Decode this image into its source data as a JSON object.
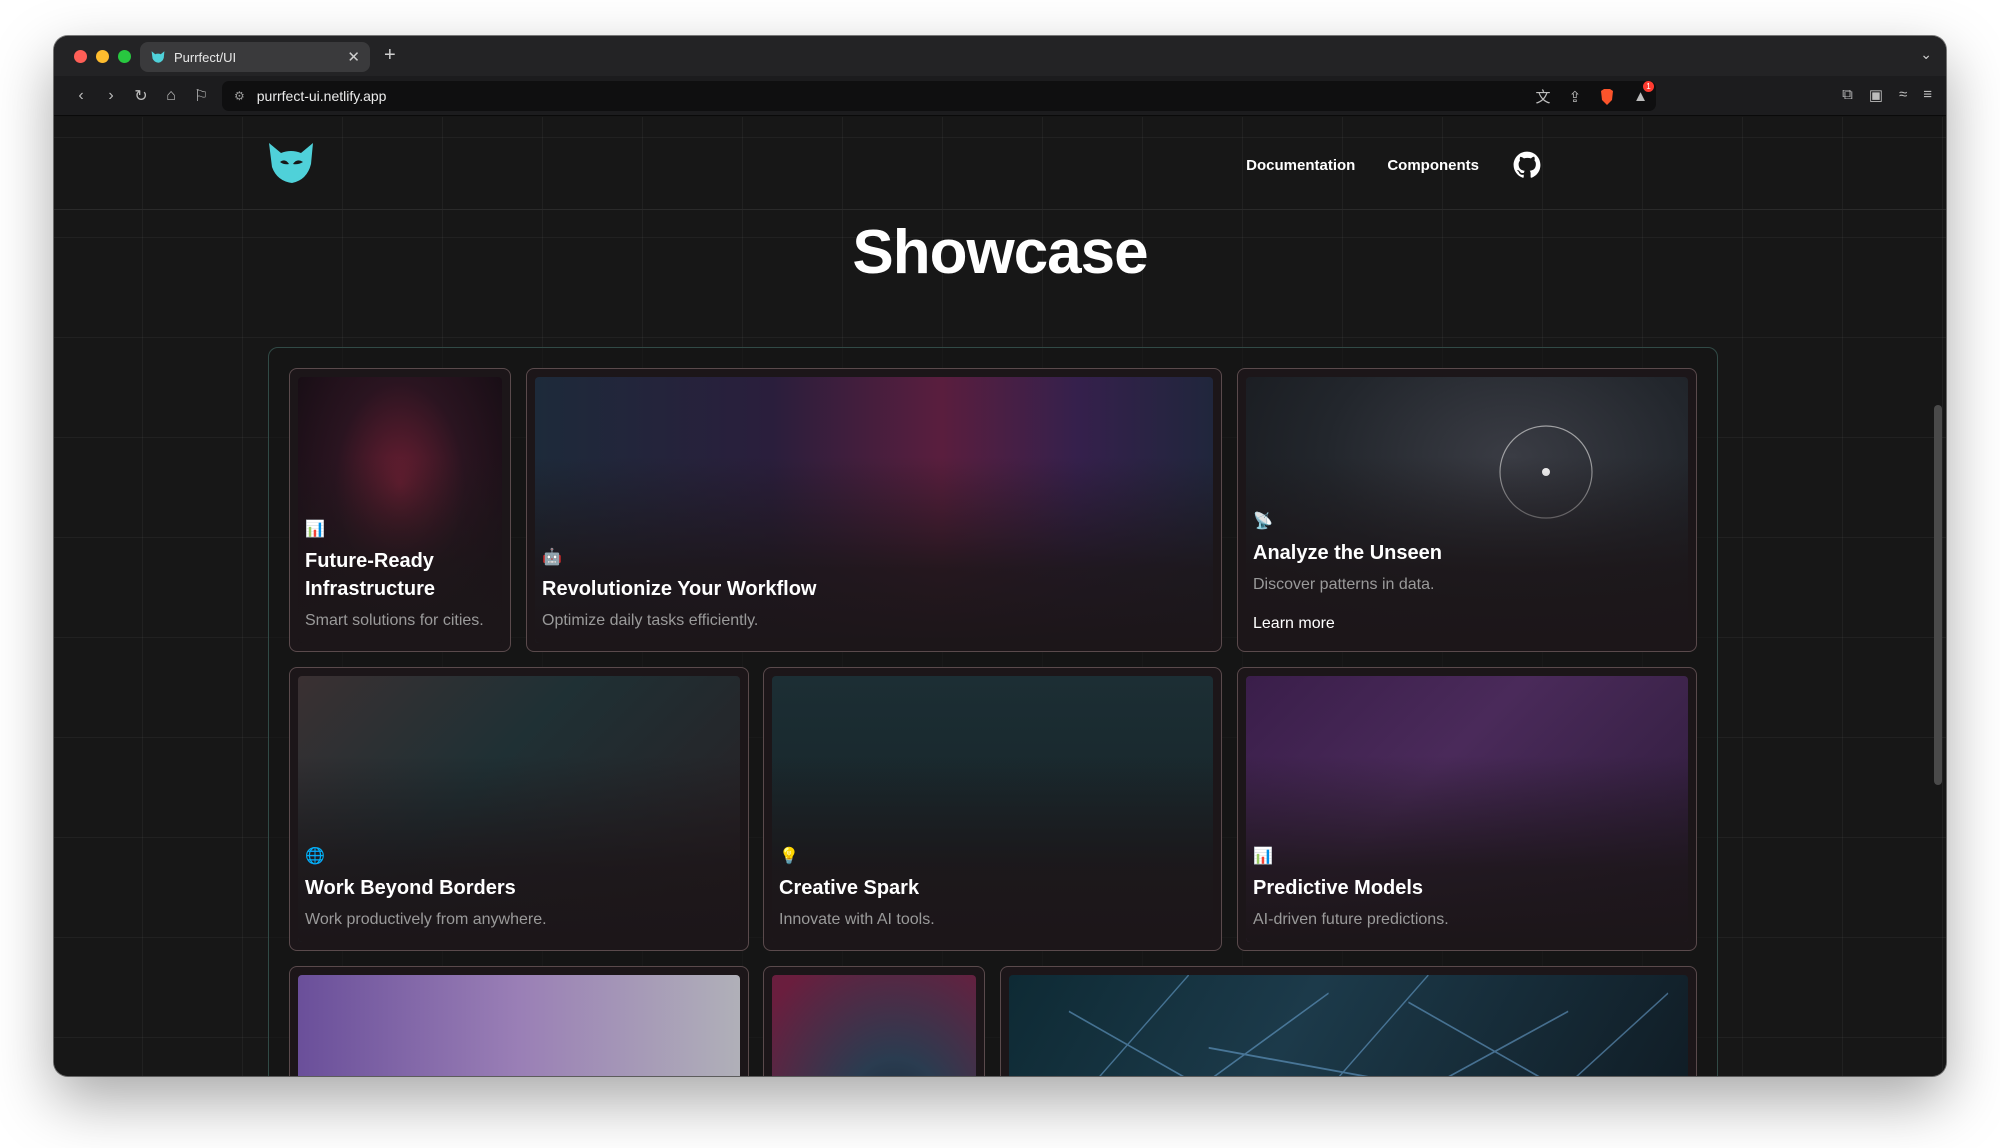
{
  "browser": {
    "tab_title": "Purrfect/UI",
    "url": "purrfect-ui.netlify.app",
    "notification_count": "1"
  },
  "site": {
    "nav": {
      "documentation": "Documentation",
      "components": "Components"
    },
    "page_title": "Showcase",
    "accent_color": "#4fd1d9"
  },
  "cards": {
    "infrastructure": {
      "icon": "chart-icon",
      "emoji": "📊",
      "title": "Future-Ready Infrastructure",
      "description": "Smart solutions for cities."
    },
    "workflow": {
      "icon": "robot-icon",
      "emoji": "🤖",
      "title": "Revolutionize Your Workflow",
      "description": "Optimize daily tasks efficiently."
    },
    "analyze": {
      "icon": "satellite-icon",
      "emoji": "📡",
      "title": "Analyze the Unseen",
      "description": "Discover patterns in data.",
      "link": "Learn more"
    },
    "borders": {
      "icon": "globe-icon",
      "emoji": "🌐",
      "title": "Work Beyond Borders",
      "description": "Work productively from anywhere."
    },
    "spark": {
      "icon": "lightbulb-icon",
      "emoji": "💡",
      "title": "Creative Spark",
      "description": "Innovate with AI tools."
    },
    "models": {
      "icon": "bar-chart-icon",
      "emoji": "📊",
      "title": "Predictive Models",
      "description": "AI-driven future predictions."
    }
  }
}
